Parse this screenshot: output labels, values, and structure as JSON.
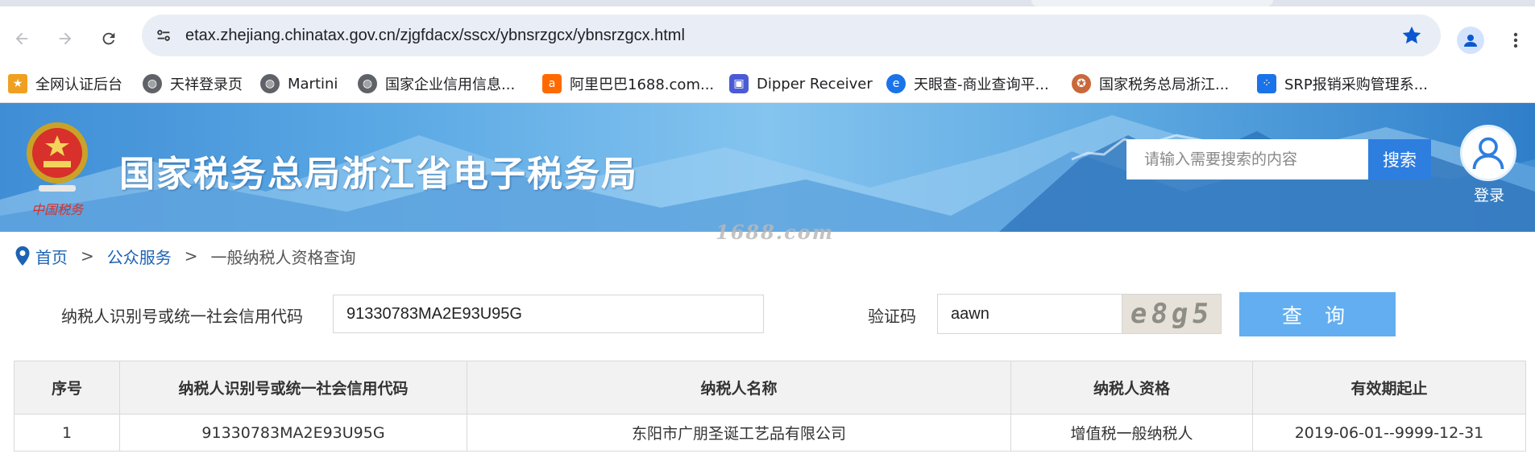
{
  "browser": {
    "url": "etax.zhejiang.chinatax.gov.cn/zjgfdacx/sscx/ybnsrzgcx/ybnsrzgcx.html",
    "bookmarks": [
      {
        "label": "全网认证后台",
        "icon": "bookmark-favicon-orange",
        "color": "#f0a020"
      },
      {
        "label": "天祥登录页",
        "icon": "globe-icon",
        "color": "#5f6368"
      },
      {
        "label": "Martini",
        "icon": "globe-icon",
        "color": "#5f6368"
      },
      {
        "label": "国家企业信用信息...",
        "icon": "globe-icon",
        "color": "#5f6368"
      },
      {
        "label": "阿里巴巴1688.com...",
        "icon": "alibaba-icon",
        "color": "#ff6a00"
      },
      {
        "label": "Dipper Receiver",
        "icon": "lock-bag-icon",
        "color": "#4a5bd4"
      },
      {
        "label": "天眼查-商业查询平...",
        "icon": "tianyancha-icon",
        "color": "#1a73e8"
      },
      {
        "label": "国家税务总局浙江...",
        "icon": "tax-emblem-icon",
        "color": "#c9683a"
      },
      {
        "label": "SRP报销采购管理系...",
        "icon": "srp-icon",
        "color": "#1a73e8"
      }
    ]
  },
  "header": {
    "site_title": "国家税务总局浙江省电子税务局",
    "emblem_caption": "中国税务",
    "search_placeholder": "请输入需要搜索的内容",
    "search_button": "搜索",
    "login_label": "登录"
  },
  "watermark": "1688.com",
  "breadcrumb": {
    "home": "首页",
    "separator": ">",
    "public_service": "公众服务",
    "current": "一般纳税人资格查询"
  },
  "form": {
    "taxpayer_id_label": "纳税人识别号或统一社会信用代码",
    "taxpayer_id_value": "91330783MA2E93U95G",
    "captcha_label": "验证码",
    "captcha_value": "aawn",
    "captcha_image_text": "e8g5",
    "query_button": "查 询"
  },
  "table": {
    "headers": [
      "序号",
      "纳税人识别号或统一社会信用代码",
      "纳税人名称",
      "纳税人资格",
      "有效期起止"
    ],
    "rows": [
      [
        "1",
        "91330783MA2E93U95G",
        "东阳市广朋圣诞工艺品有限公司",
        "增值税一般纳税人",
        "2019-06-01--9999-12-31"
      ]
    ]
  },
  "colors": {
    "link_blue": "#1d63b4",
    "search_button": "#2e7ee0",
    "query_button": "#62aef0",
    "table_header_bg": "#f2f2f2"
  }
}
